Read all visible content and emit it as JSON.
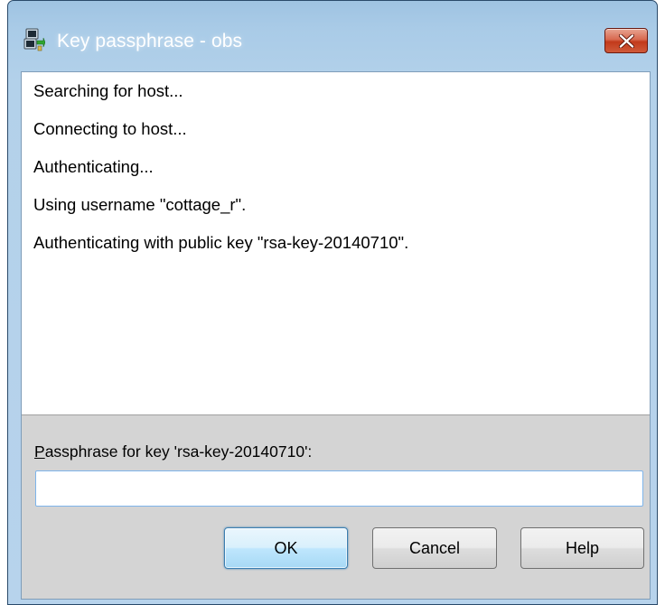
{
  "window": {
    "title": "Key passphrase - obs",
    "app_icon": "putty-icon",
    "close_icon": "close-icon"
  },
  "log": {
    "lines": [
      "Searching for host...",
      "Connecting to host...",
      "Authenticating...",
      "Using username \"cottage_r\".",
      "Authenticating with public key \"rsa-key-20140710\"."
    ]
  },
  "passphrase": {
    "label_mnemonic": "P",
    "label_rest": "assphrase for key 'rsa-key-20140710':",
    "value": "",
    "placeholder": ""
  },
  "buttons": {
    "ok": "OK",
    "cancel": "Cancel",
    "help": "Help"
  },
  "colors": {
    "title_bar": "#a9cbe7",
    "close_button": "#c23a1b",
    "default_button_border": "#3c7fb1",
    "input_focus_border": "#7eb4ea"
  }
}
